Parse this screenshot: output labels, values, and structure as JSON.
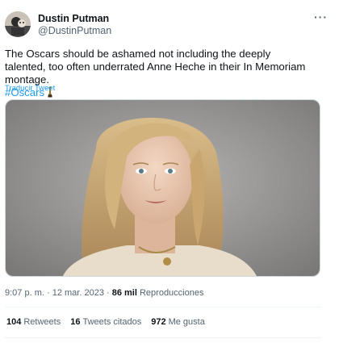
{
  "author": {
    "name": "Dustin Putman",
    "handle": "@DustinPutman"
  },
  "tweet": {
    "text": "The Oscars should be ashamed not including the deeply talented, too often underrated Anne Heche in their In Memoriam montage.",
    "hashtag": "#Oscars",
    "hashtag_emoji": "trophy-icon",
    "translate_label": "Traducir Tweet"
  },
  "meta": {
    "time": "9:07 p. m.",
    "separator": "·",
    "date": "12 mar. 2023",
    "separator2": "·",
    "views_count": "86 mil",
    "views_label": "Reproducciones"
  },
  "stats": {
    "retweets_count": "104",
    "retweets_label": "Retweets",
    "quotes_count": "16",
    "quotes_label": "Tweets citados",
    "likes_count": "972",
    "likes_label": "Me gusta"
  },
  "colors": {
    "accent": "#1d9bf0",
    "secondary_text": "#536471",
    "primary_text": "#0f1419"
  },
  "icons": {
    "more": "more-options-icon"
  }
}
